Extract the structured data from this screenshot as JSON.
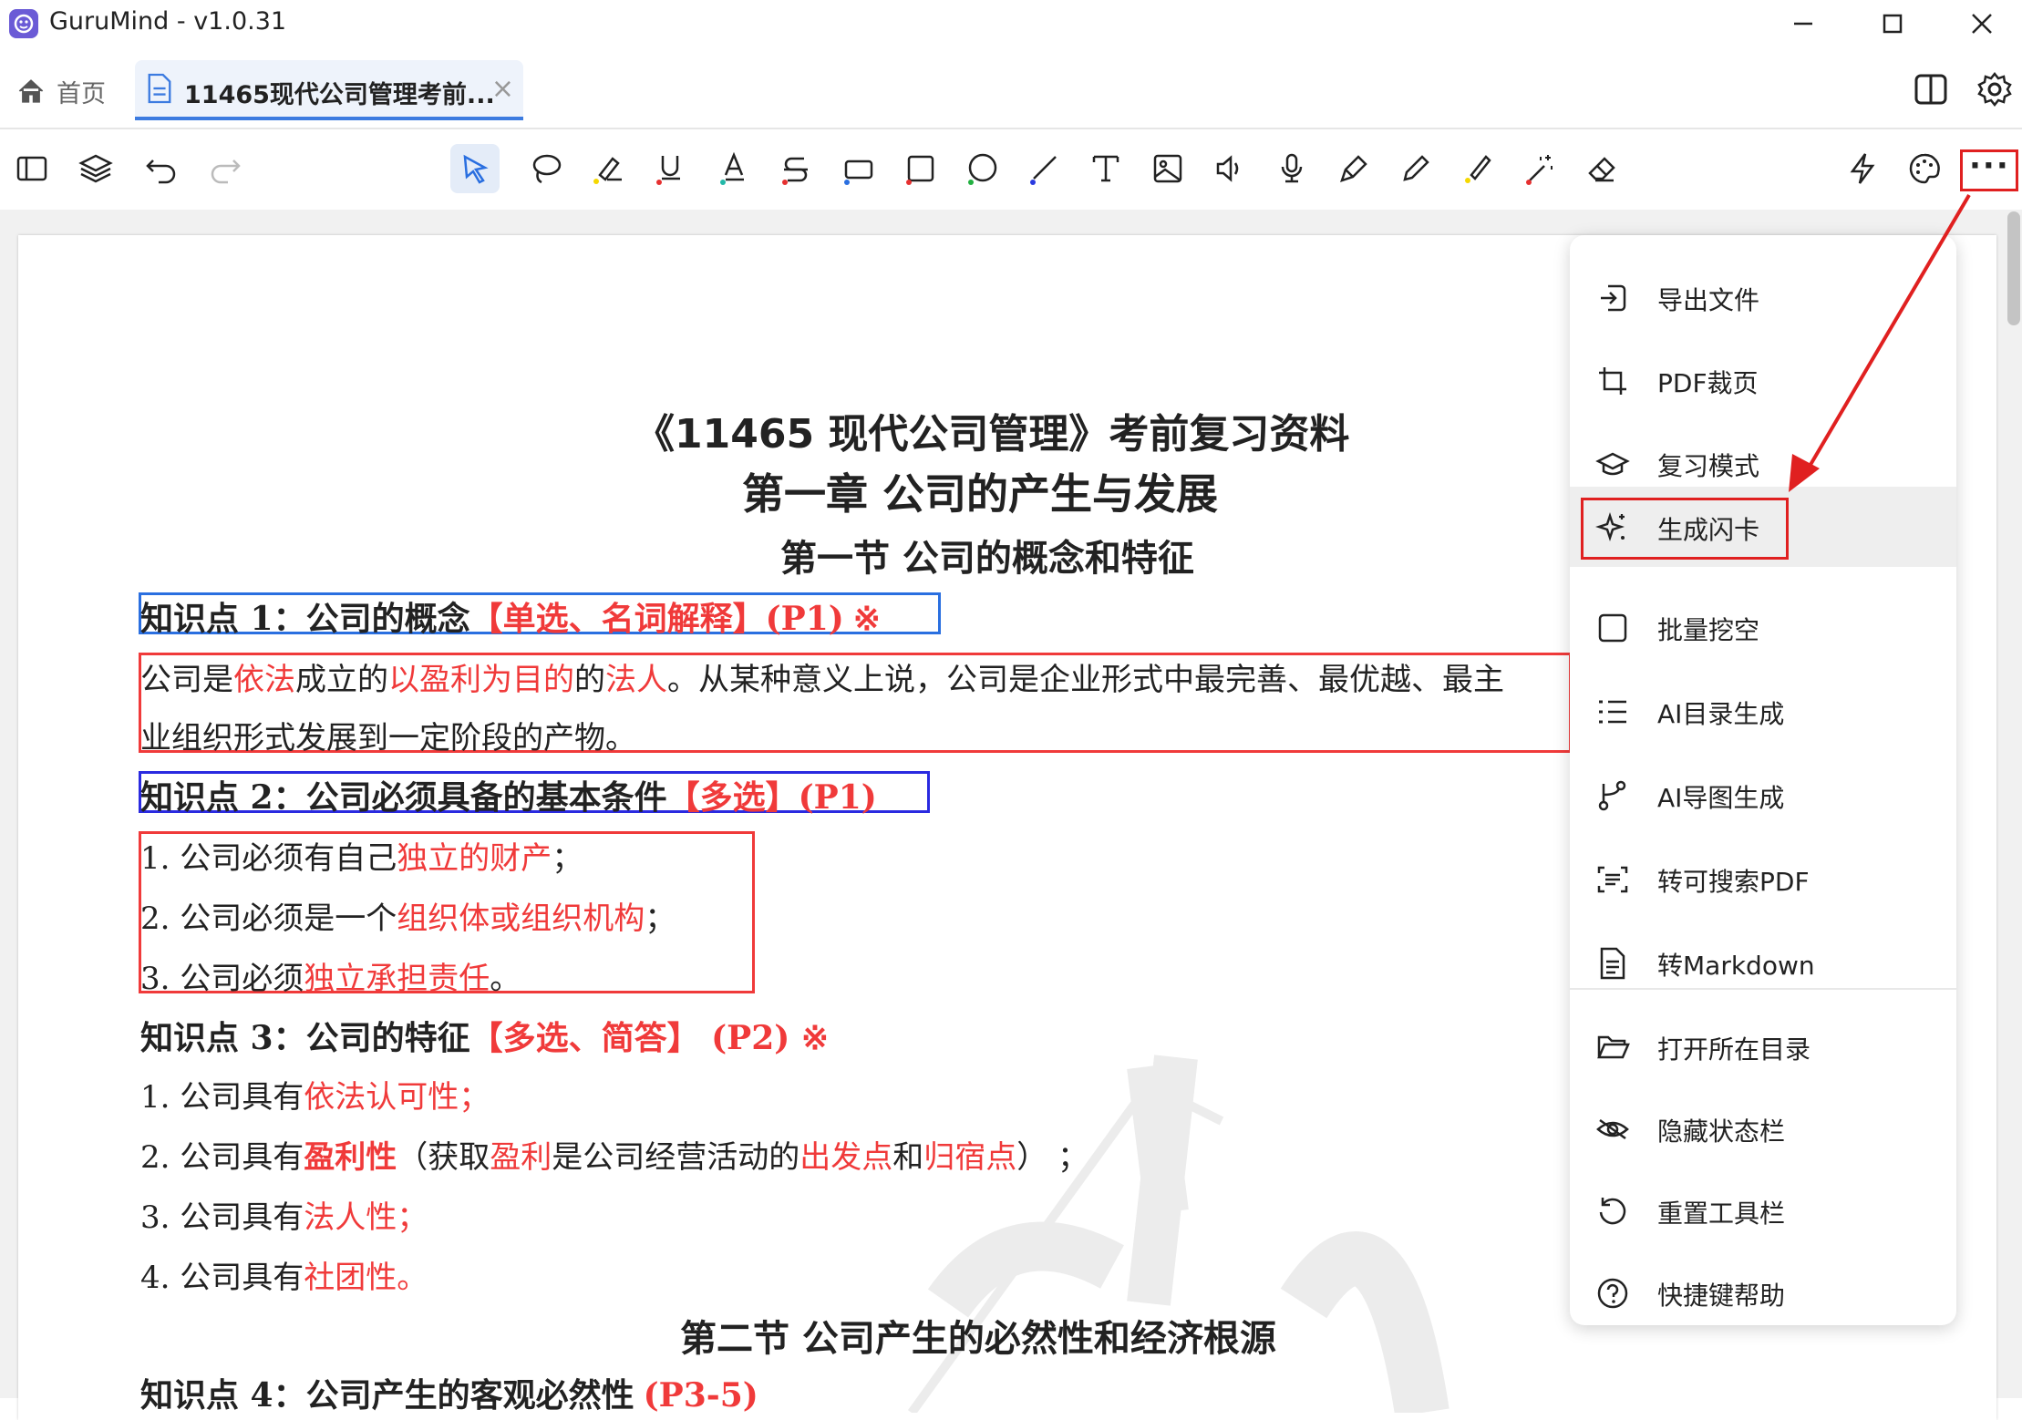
{
  "window": {
    "title": "GuruMind - v1.0.31",
    "controls": [
      "minimize",
      "maximize",
      "close"
    ]
  },
  "tabs": {
    "home_label": "首页",
    "doc_tab_label": "11465现代公司管理考前...",
    "close_glyph": "×"
  },
  "toolbar": {
    "left": [
      "sidebar-toggle-icon",
      "layers-icon",
      "undo-icon",
      "redo-icon"
    ],
    "tools": [
      "select-icon",
      "lasso-icon",
      "highlight-icon",
      "underline-icon",
      "text-color-icon",
      "strikethrough-icon",
      "text-box-icon",
      "rectangle-icon",
      "ellipse-icon",
      "line-icon",
      "text-icon",
      "image-icon",
      "audio-icon",
      "microphone-icon",
      "pen-icon",
      "pencil-icon",
      "brush-icon",
      "magic-wand-icon",
      "eraser-icon"
    ],
    "right": [
      "flash-icon",
      "palette-icon",
      "more-icon"
    ],
    "more_label": "···"
  },
  "document": {
    "title": "《11465 现代公司管理》考前复习资料",
    "chapter": "第一章  公司的产生与发展",
    "section1": "第一节  公司的概念和特征",
    "kp1": {
      "prefix": "知识点 1：公司的概念",
      "tag": "【单选、名词解释】(P1)",
      "mark": "※"
    },
    "p1": {
      "line1_a": "公司是",
      "line1_b": "依法",
      "line1_c": "成立的",
      "line1_d": "以盈利为目的",
      "line1_e": "的",
      "line1_f": "法人",
      "line1_g": "。从某种意义上说，公司是企业形式中最完善、最优越、最主",
      "line2": "业组织形式发展到一定阶段的产物。"
    },
    "kp2": {
      "prefix": "知识点 2：公司必须具备的基本条件",
      "tag": "【多选】(P1)"
    },
    "list1": [
      {
        "num": "1.  公司必须有自己",
        "red": "独立的财产",
        "end": "；"
      },
      {
        "num": "2.  公司必须是一个",
        "red": "组织体或组织机构",
        "end": "；"
      },
      {
        "num": "3.  公司必须",
        "red": "独立承担责任",
        "end": "。"
      }
    ],
    "kp3": {
      "prefix": "知识点 3：公司的特征",
      "tag": "【多选、简答】 (P2) ※"
    },
    "list2": [
      {
        "a": "1. 公司具有",
        "b": "依法认可性；"
      },
      {
        "a": "2. 公司具有",
        "b": "盈利性",
        "c": "（获取",
        "d": "盈利",
        "e": "是公司经营活动的",
        "f": "出发点",
        "g": "和",
        "h": "归宿点",
        "i": "）  ；"
      },
      {
        "a": "3. 公司具有",
        "b": "法人性；"
      },
      {
        "a": "4. 公司具有",
        "b": "社团性。"
      }
    ],
    "section2": "第二节  公司产生的必然性和经济根源",
    "kp4": {
      "prefix": "知识点 4：公司产生的客观必然性",
      "tag": "(P3-5)"
    }
  },
  "menu": {
    "items": [
      {
        "label": "导出文件",
        "icon": "export-icon"
      },
      {
        "label": "PDF裁页",
        "icon": "crop-icon"
      },
      {
        "label": "复习模式",
        "icon": "graduation-cap-icon"
      },
      {
        "label": "生成闪卡",
        "icon": "sparkle-icon"
      },
      {
        "label": "批量挖空",
        "icon": "square-icon"
      },
      {
        "label": "AI目录生成",
        "icon": "list-icon"
      },
      {
        "label": "AI导图生成",
        "icon": "branch-icon"
      },
      {
        "label": "转可搜索PDF",
        "icon": "scan-text-icon"
      },
      {
        "label": "转Markdown",
        "icon": "document-icon"
      },
      {
        "label": "打开所在目录",
        "icon": "folder-open-icon"
      },
      {
        "label": "隐藏状态栏",
        "icon": "eye-off-icon"
      },
      {
        "label": "重置工具栏",
        "icon": "reset-icon"
      },
      {
        "label": "快捷键帮助",
        "icon": "help-icon"
      }
    ],
    "highlighted": "生成闪卡"
  },
  "colors": {
    "accent": "#3c7be0",
    "annotation_red": "#e02020",
    "doc_red": "#f03a3a",
    "box_blue": "#2a6fe0",
    "box_blue2": "#2a2ae0"
  }
}
